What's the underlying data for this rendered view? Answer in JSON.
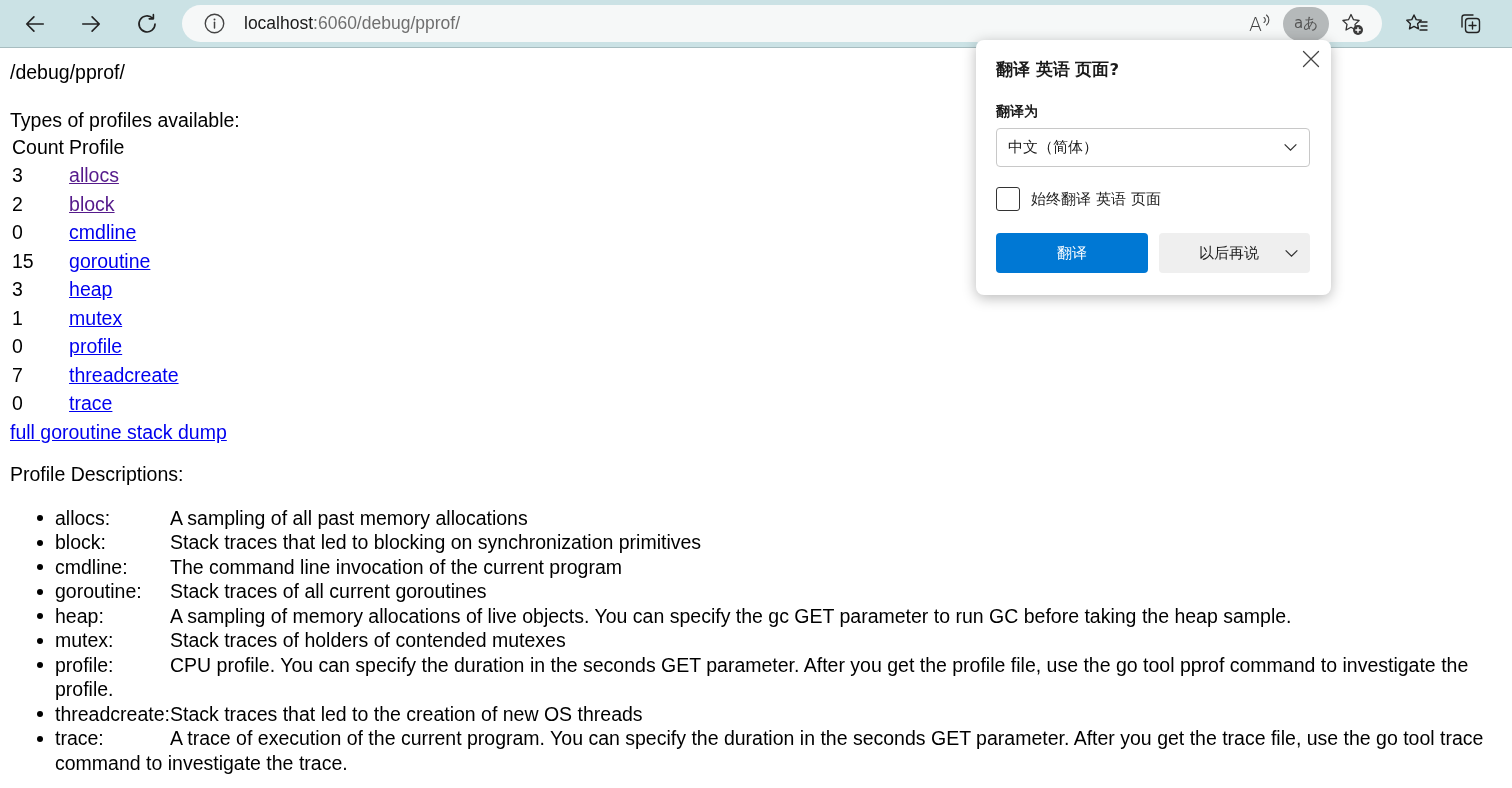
{
  "browser": {
    "address": {
      "host": "localhost",
      "path": ":6060/debug/pprof/"
    },
    "read_aloud": {
      "glyph": "A"
    },
    "translate": {
      "glyph": "aあ",
      "active": true
    }
  },
  "page": {
    "title": "/debug/pprof/",
    "intro": "Types of profiles available:",
    "table": {
      "columns": [
        "Count",
        "Profile"
      ],
      "rows": [
        {
          "count": "3",
          "profile": "allocs",
          "visited": true
        },
        {
          "count": "2",
          "profile": "block",
          "visited": true
        },
        {
          "count": "0",
          "profile": "cmdline",
          "visited": false
        },
        {
          "count": "15",
          "profile": "goroutine",
          "visited": false
        },
        {
          "count": "3",
          "profile": "heap",
          "visited": false
        },
        {
          "count": "1",
          "profile": "mutex",
          "visited": false
        },
        {
          "count": "0",
          "profile": "profile",
          "visited": false
        },
        {
          "count": "7",
          "profile": "threadcreate",
          "visited": false
        },
        {
          "count": "0",
          "profile": "trace",
          "visited": false
        }
      ]
    },
    "full_dump_link": {
      "label": "full goroutine stack dump",
      "visited": false
    },
    "descriptions_heading": "Profile Descriptions:",
    "descriptions": [
      {
        "term": "allocs:",
        "text": "A sampling of all past memory allocations"
      },
      {
        "term": "block:",
        "text": "Stack traces that led to blocking on synchronization primitives"
      },
      {
        "term": "cmdline:",
        "text": "The command line invocation of the current program"
      },
      {
        "term": "goroutine:",
        "text": "Stack traces of all current goroutines"
      },
      {
        "term": "heap:",
        "text": "A sampling of memory allocations of live objects. You can specify the gc GET parameter to run GC before taking the heap sample."
      },
      {
        "term": "mutex:",
        "text": "Stack traces of holders of contended mutexes"
      },
      {
        "term": "profile:",
        "text": "CPU profile. You can specify the duration in the seconds GET parameter. After you get the profile file, use the go tool pprof command to investigate the profile."
      },
      {
        "term": "threadcreate:",
        "text": "Stack traces that led to the creation of new OS threads"
      },
      {
        "term": "trace:",
        "text": "A trace of execution of the current program. You can specify the duration in the seconds GET parameter. After you get the trace file, use the go tool trace command to investigate the trace."
      }
    ]
  },
  "translate_popup": {
    "title": "翻译 英语 页面?",
    "language_field": {
      "label": "翻译为",
      "value": "中文（简体）"
    },
    "always_translate": {
      "label": "始终翻译 英语 页面",
      "checked": false
    },
    "buttons": [
      {
        "label": "翻译",
        "kind": "primary"
      },
      {
        "label": "以后再说",
        "kind": "dropdown"
      }
    ]
  }
}
